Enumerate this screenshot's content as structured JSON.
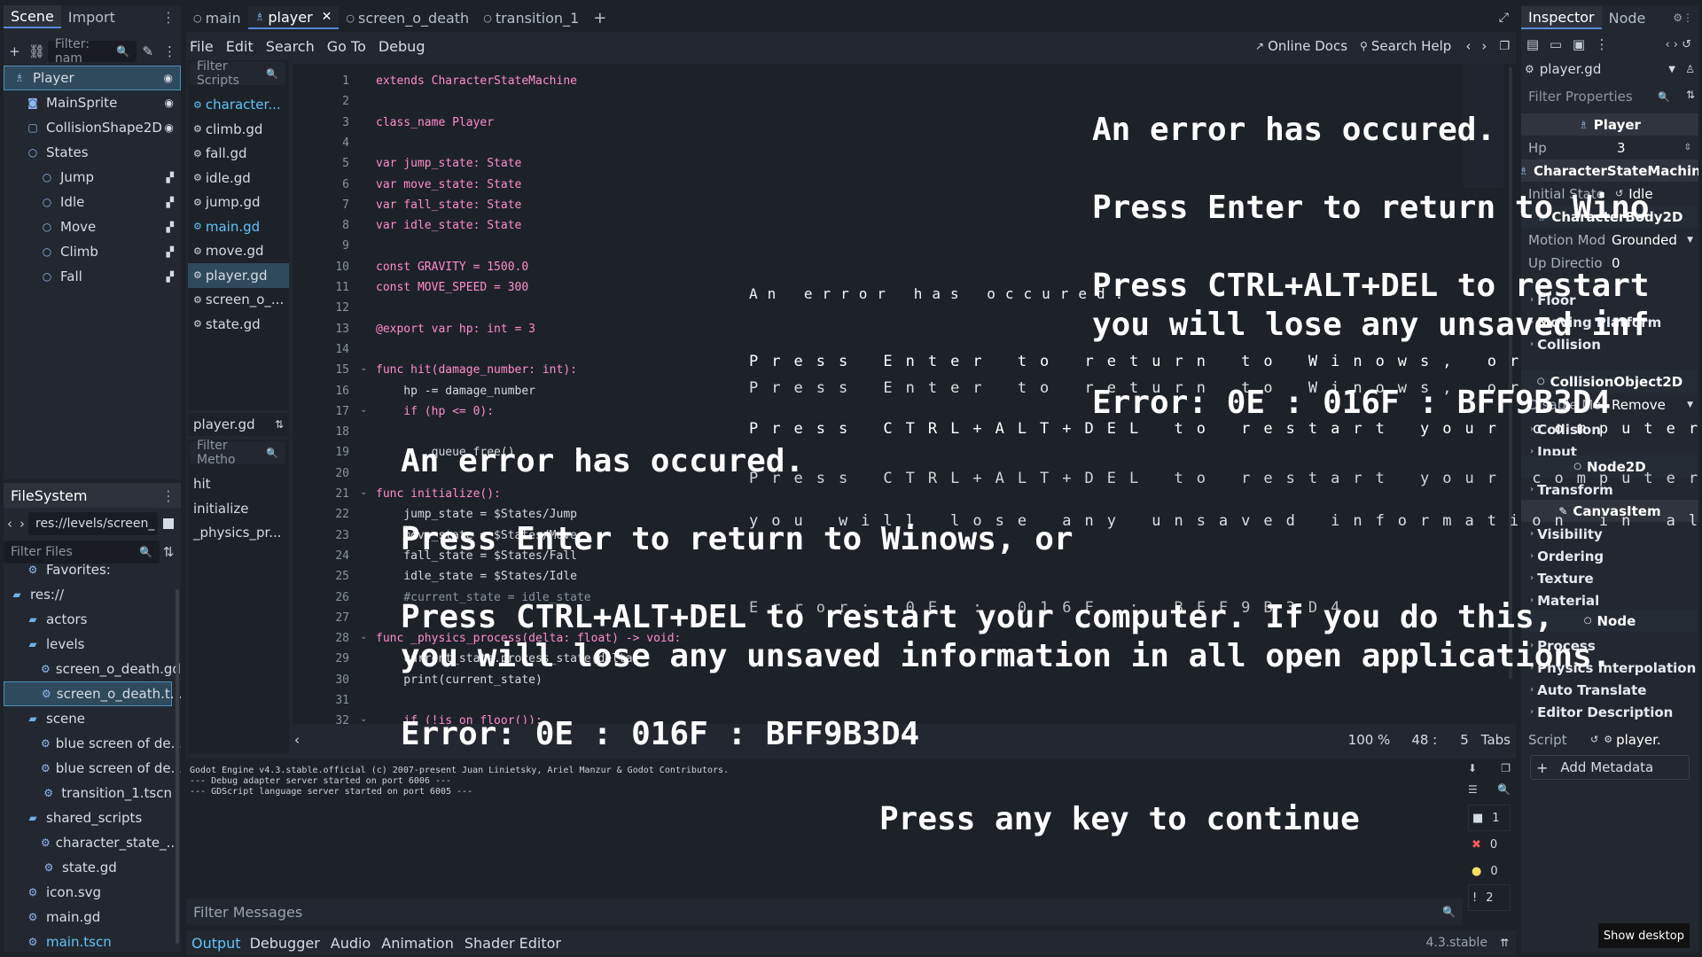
{
  "scene_dock": {
    "tabs": [
      "Scene",
      "Import"
    ],
    "filter_placeholder": "Filter: nam",
    "tree": [
      {
        "label": "Player",
        "icon": "character-icon",
        "indent": 0
      },
      {
        "label": "MainSprite",
        "icon": "sprite-icon",
        "indent": 1
      },
      {
        "label": "CollisionShape2D",
        "icon": "collision-icon",
        "indent": 1
      },
      {
        "label": "States",
        "icon": "node-icon",
        "indent": 1
      },
      {
        "label": "Jump",
        "icon": "node-icon",
        "indent": 2
      },
      {
        "label": "Idle",
        "icon": "node-icon",
        "indent": 2
      },
      {
        "label": "Move",
        "icon": "node-icon",
        "indent": 2
      },
      {
        "label": "Climb",
        "icon": "node-icon",
        "indent": 2
      },
      {
        "label": "Fall",
        "icon": "node-icon",
        "indent": 2
      }
    ]
  },
  "filesystem": {
    "title": "FileSystem",
    "path": "res://levels/screen_",
    "filter_placeholder": "Filter Files",
    "items": [
      {
        "label": "Favorites:",
        "indent": 1
      },
      {
        "label": "res://",
        "indent": 0
      },
      {
        "label": "actors",
        "indent": 1
      },
      {
        "label": "levels",
        "indent": 1
      },
      {
        "label": "screen_o_death.gd",
        "indent": 2
      },
      {
        "label": "screen_o_death.t...",
        "indent": 2
      },
      {
        "label": "scene",
        "indent": 1
      },
      {
        "label": "blue screen of de...",
        "indent": 2
      },
      {
        "label": "blue screen of de...",
        "indent": 2
      },
      {
        "label": "transition_1.tscn",
        "indent": 2
      },
      {
        "label": "shared_scripts",
        "indent": 1
      },
      {
        "label": "character_state_...",
        "indent": 2
      },
      {
        "label": "state.gd",
        "indent": 2
      },
      {
        "label": "icon.svg",
        "indent": 1
      },
      {
        "label": "main.gd",
        "indent": 1
      },
      {
        "label": "main.tscn",
        "indent": 1
      }
    ]
  },
  "editor_tabs": [
    "main",
    "player",
    "screen_o_death",
    "transition_1"
  ],
  "menu": [
    "File",
    "Edit",
    "Search",
    "Go To",
    "Debug"
  ],
  "help_links": [
    "Online Docs",
    "Search Help"
  ],
  "scripts": {
    "filter_placeholder": "Filter Scripts",
    "items": [
      "character...",
      "climb.gd",
      "fall.gd",
      "idle.gd",
      "jump.gd",
      "main.gd",
      "move.gd",
      "player.gd",
      "screen_o_...",
      "state.gd"
    ],
    "current": "player.gd",
    "methods_filter_placeholder": "Filter Metho",
    "methods": [
      "hit",
      "initialize",
      "_physics_pr..."
    ]
  },
  "code_lines": [
    {
      "n": "1",
      "t": "extends CharacterStateMachine"
    },
    {
      "n": "2",
      "t": ""
    },
    {
      "n": "3",
      "t": "class_name Player"
    },
    {
      "n": "4",
      "t": ""
    },
    {
      "n": "5",
      "t": "var jump_state: State"
    },
    {
      "n": "6",
      "t": "var move_state: State"
    },
    {
      "n": "7",
      "t": "var fall_state: State"
    },
    {
      "n": "8",
      "t": "var idle_state: State"
    },
    {
      "n": "9",
      "t": ""
    },
    {
      "n": "10",
      "t": "const GRAVITY = 1500.0"
    },
    {
      "n": "11",
      "t": "const MOVE_SPEED = 300"
    },
    {
      "n": "12",
      "t": ""
    },
    {
      "n": "13",
      "t": "@export var hp: int = 3"
    },
    {
      "n": "14",
      "t": ""
    },
    {
      "n": "15",
      "t": "func hit(damage_number: int):"
    },
    {
      "n": "16",
      "t": "    hp -= damage_number"
    },
    {
      "n": "17",
      "t": "    if (hp <= 0):"
    },
    {
      "n": "18",
      "t": ""
    },
    {
      "n": "19",
      "t": "        queue_free()"
    },
    {
      "n": "20",
      "t": ""
    },
    {
      "n": "21",
      "t": "func initialize():"
    },
    {
      "n": "22",
      "t": "    jump_state = $States/Jump"
    },
    {
      "n": "23",
      "t": "    move_state = $States/Move"
    },
    {
      "n": "24",
      "t": "    fall_state = $States/Fall"
    },
    {
      "n": "25",
      "t": "    idle_state = $States/Idle"
    },
    {
      "n": "26",
      "t": "    #current_state = idle_state"
    },
    {
      "n": "27",
      "t": ""
    },
    {
      "n": "28",
      "t": "func _physics_process(delta: float) -> void:"
    },
    {
      "n": "29",
      "t": "    current_state.process_state(delta)"
    },
    {
      "n": "30",
      "t": "    print(current_state)"
    },
    {
      "n": "31",
      "t": ""
    },
    {
      "n": "32",
      "t": "    if (!is_on_floor()):"
    }
  ],
  "status": {
    "zoom": "100 %",
    "line": "48 :",
    "col": "5",
    "indent": "Tabs"
  },
  "output": {
    "lines": [
      "Godot Engine v4.3.stable.official (c) 2007-present Juan Linietsky, Ariel Manzur & Godot Contributors.",
      "--- Debug adapter server started on port 6006 ---",
      "--- GDScript language server started on port 6005 ---"
    ],
    "filter_placeholder": "Filter Messages",
    "counts": [
      "1",
      "0",
      "0",
      "2"
    ]
  },
  "bottom_tabs": [
    "Output",
    "Debugger",
    "Audio",
    "Animation",
    "Shader Editor"
  ],
  "version": "4.3.stable",
  "inspector": {
    "tabs": [
      "Inspector",
      "Node"
    ],
    "resource": "player.gd",
    "filter_placeholder": "Filter Properties",
    "class_player": "Player",
    "hp_label": "Hp",
    "hp_value": "3",
    "class_csm": "CharacterStateMachin",
    "initial_state_label": "Initial State",
    "initial_state_value": "Idle",
    "class_body": "CharacterBody2D",
    "motion_mode_label": "Motion Mod",
    "motion_mode_value": "Grounded",
    "up_direction_label": "Up Directio",
    "up_direction_value": "0",
    "sections": [
      "Floor",
      "Moving Platform",
      "Collision"
    ],
    "class_collision_obj": "CollisionObject2D",
    "disable_mode_label": "Disable Mo",
    "disable_mode_value": "Remove",
    "sections2": [
      "Collision",
      "Input"
    ],
    "class_node2d": "Node2D",
    "sections3": [
      "Transform"
    ],
    "class_canvas": "CanvasItem",
    "sections4": [
      "Visibility",
      "Ordering",
      "Texture",
      "Material"
    ],
    "class_node": "Node",
    "sections5": [
      "Process",
      "Physics Interpolation",
      "Auto Translate",
      "Editor Description"
    ],
    "script_label": "Script",
    "script_value": "player.",
    "add_metadata": "Add Metadata"
  },
  "show_desktop": "Show desktop",
  "error_overlay": {
    "large": {
      "title": "An error has occured.",
      "line1": "Press Enter to return to Winows, or",
      "line2": "Press CTRL+ALT+DEL to restart your computer. If you do this,",
      "line3": "you will lose any unsaved information in all open applications.",
      "code": "Error: 0E : 016F : BFF9B3D4"
    },
    "right": {
      "title": "An error has occured.",
      "line1": "Press Enter to return to Wino",
      "line2": "Press CTRL+ALT+DEL to restart",
      "line3": "you will lose any unsaved inf",
      "code": "Error: 0E : 016F : BFF9B3D4"
    },
    "small": {
      "title": "An error has occured.",
      "line1": "Press Enter to return to Winows, or",
      "line2": "Press CTRL+ALT+DEL to restart your computer.",
      "line3": "you will lose any unsaved information in all",
      "code": "Error: 0E : 016F : BFF9B3D4"
    },
    "continue": "Press any key to continue"
  }
}
